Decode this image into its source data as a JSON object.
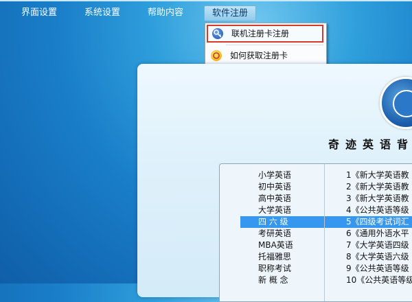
{
  "menu": {
    "items": [
      {
        "label": "界面设置"
      },
      {
        "label": "系统设置"
      },
      {
        "label": "帮助内容"
      },
      {
        "label": "软件注册"
      }
    ],
    "active_index": 3
  },
  "dropdown": {
    "items": [
      {
        "label": "联机注册卡注册",
        "icon": "key-icon"
      },
      {
        "label": "如何获取注册卡",
        "icon": "question-icon"
      }
    ]
  },
  "app": {
    "title": "奇迹英语背"
  },
  "categories": [
    "小学英语",
    "初中英语",
    "高中英语",
    "大学英语",
    "四 六 级",
    "考研英语",
    "MBA英语",
    "托福雅思",
    "职称考试",
    "新 概 念"
  ],
  "selected_category_index": 4,
  "books": [
    "1《新大学英语教",
    "2《新大学英语教",
    "3《新大学英语教",
    "4《公共英语等级",
    "5《四级考试词汇",
    "6《通用外语水平",
    "7《大学英语四级",
    "8《大学英语六级",
    "9《公共英语等级",
    "10《公共英语等级"
  ],
  "selected_book_index": 4,
  "colors": {
    "selection": "#3597ef",
    "highlight_border": "#d23b2a",
    "menu_text": "#ffffff"
  }
}
